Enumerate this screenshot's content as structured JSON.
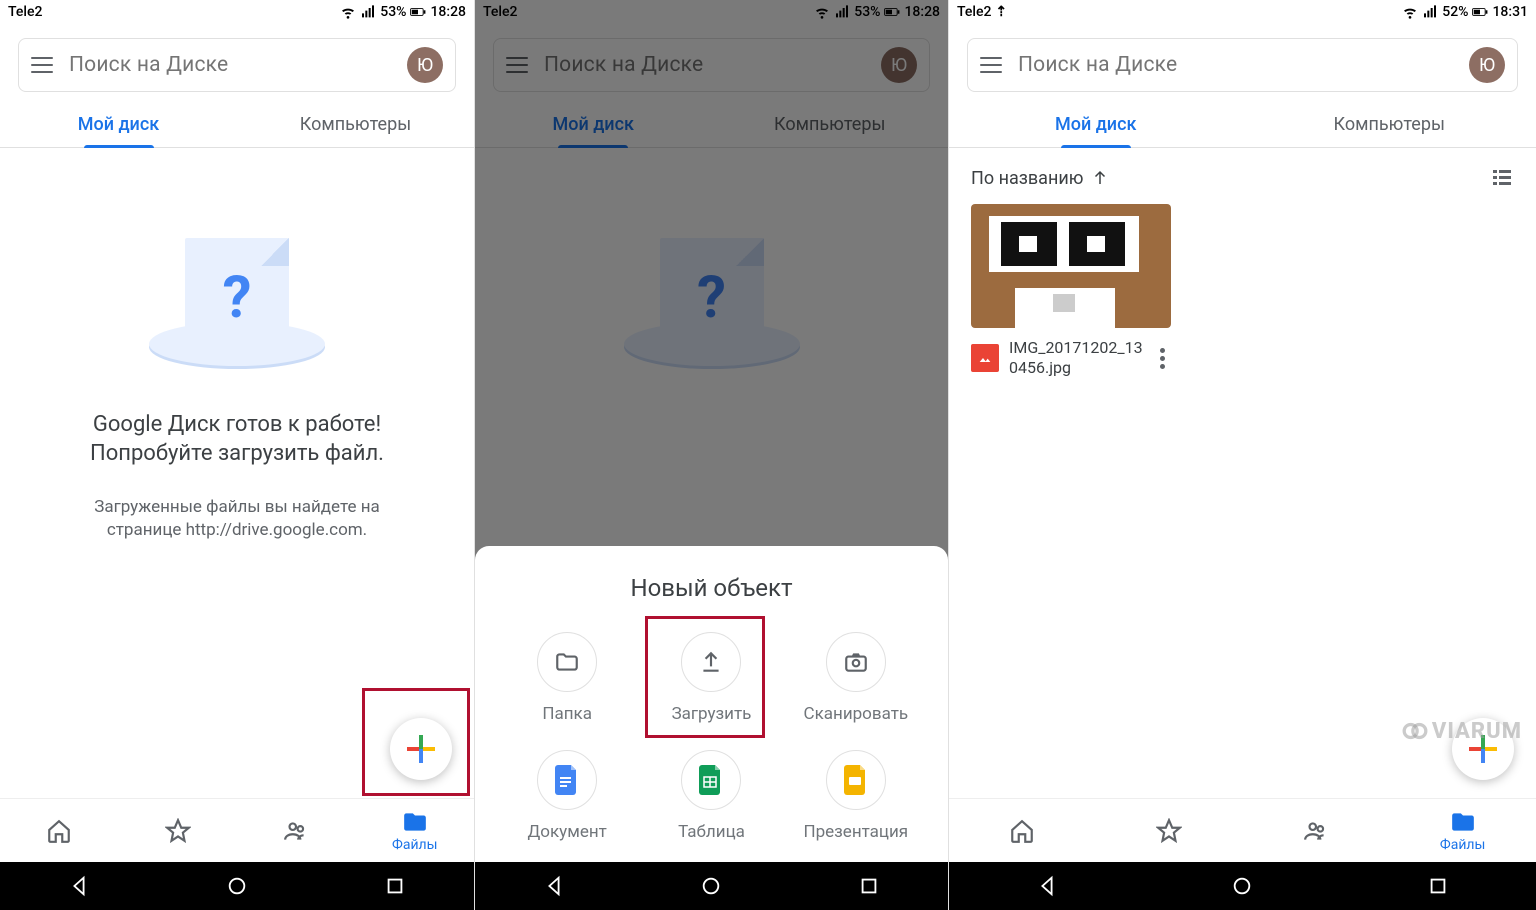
{
  "status": {
    "carrier": "Tele2",
    "battery_p1": "53%",
    "time_p1": "18:28",
    "battery_p3": "52%",
    "time_p3": "18:31"
  },
  "search": {
    "placeholder": "Поиск на Диске",
    "avatar_initial": "Ю"
  },
  "tabs": {
    "my_drive": "Мой диск",
    "computers": "Компьютеры"
  },
  "empty": {
    "title": "Google Диск готов к работе!",
    "subtitle": "Попробуйте загрузить файл.",
    "note_l1": "Загруженные файлы вы найдете на",
    "note_l2": "странице http://drive.google.com."
  },
  "nav": {
    "files": "Файлы"
  },
  "sheet": {
    "title": "Новый объект",
    "items": {
      "folder": "Папка",
      "upload": "Загрузить",
      "scan": "Сканировать",
      "doc": "Документ",
      "sheet": "Таблица",
      "slides": "Презентация"
    }
  },
  "sort": {
    "label": "По названию"
  },
  "file": {
    "name": "IMG_20171202_130456.jpg"
  },
  "watermark": "VIARUM"
}
